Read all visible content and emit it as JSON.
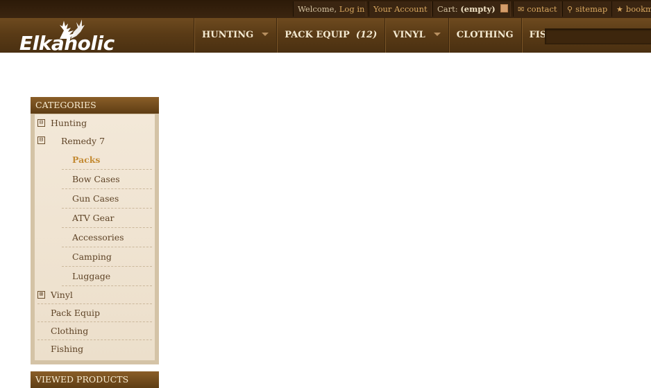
{
  "topbar": {
    "welcome": "Welcome,",
    "login": "Log in",
    "account": "Your Account",
    "cart_label": "Cart:",
    "cart_value": "(empty)",
    "contact": "contact",
    "sitemap": "sitemap",
    "bookmark": "bookm"
  },
  "logo": {
    "text": "Elkaholic"
  },
  "nav": {
    "hunting": "HUNTING",
    "pack_equip": "PACK EQUIP",
    "pack_equip_count": "(12)",
    "vinyl": "VINYL",
    "clothing": "CLOTHING",
    "fishing": "FISHING"
  },
  "sidebar": {
    "categories_title": "CATEGORIES",
    "hunting": "Hunting",
    "remedy7": "Remedy 7",
    "packs": "Packs",
    "bow_cases": "Bow Cases",
    "gun_cases": "Gun Cases",
    "atv_gear": "ATV Gear",
    "accessories": "Accessories",
    "camping": "Camping",
    "luggage": "Luggage",
    "vinyl": "Vinyl",
    "pack_equip": "Pack Equip",
    "clothing": "Clothing",
    "fishing": "Fishing",
    "viewed_title": "VIEWED PRODUCTS"
  },
  "icons": {
    "minus": "⊟",
    "plus": "⊞",
    "contact": "mail-icon",
    "sitemap": "sitemap-icon",
    "bookmark": "star-icon"
  },
  "colors": {
    "accent": "#c48b34",
    "header": "#5a3b16",
    "panel": "#f3e8d8"
  }
}
